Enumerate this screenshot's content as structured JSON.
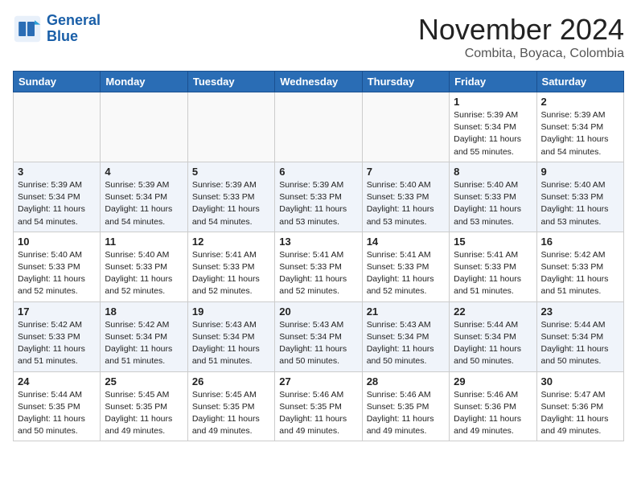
{
  "header": {
    "logo_line1": "General",
    "logo_line2": "Blue",
    "month": "November 2024",
    "location": "Combita, Boyaca, Colombia"
  },
  "days_of_week": [
    "Sunday",
    "Monday",
    "Tuesday",
    "Wednesday",
    "Thursday",
    "Friday",
    "Saturday"
  ],
  "weeks": [
    [
      {
        "day": "",
        "info": ""
      },
      {
        "day": "",
        "info": ""
      },
      {
        "day": "",
        "info": ""
      },
      {
        "day": "",
        "info": ""
      },
      {
        "day": "",
        "info": ""
      },
      {
        "day": "1",
        "info": "Sunrise: 5:39 AM\nSunset: 5:34 PM\nDaylight: 11 hours and 55 minutes."
      },
      {
        "day": "2",
        "info": "Sunrise: 5:39 AM\nSunset: 5:34 PM\nDaylight: 11 hours and 54 minutes."
      }
    ],
    [
      {
        "day": "3",
        "info": "Sunrise: 5:39 AM\nSunset: 5:34 PM\nDaylight: 11 hours and 54 minutes."
      },
      {
        "day": "4",
        "info": "Sunrise: 5:39 AM\nSunset: 5:34 PM\nDaylight: 11 hours and 54 minutes."
      },
      {
        "day": "5",
        "info": "Sunrise: 5:39 AM\nSunset: 5:33 PM\nDaylight: 11 hours and 54 minutes."
      },
      {
        "day": "6",
        "info": "Sunrise: 5:39 AM\nSunset: 5:33 PM\nDaylight: 11 hours and 53 minutes."
      },
      {
        "day": "7",
        "info": "Sunrise: 5:40 AM\nSunset: 5:33 PM\nDaylight: 11 hours and 53 minutes."
      },
      {
        "day": "8",
        "info": "Sunrise: 5:40 AM\nSunset: 5:33 PM\nDaylight: 11 hours and 53 minutes."
      },
      {
        "day": "9",
        "info": "Sunrise: 5:40 AM\nSunset: 5:33 PM\nDaylight: 11 hours and 53 minutes."
      }
    ],
    [
      {
        "day": "10",
        "info": "Sunrise: 5:40 AM\nSunset: 5:33 PM\nDaylight: 11 hours and 52 minutes."
      },
      {
        "day": "11",
        "info": "Sunrise: 5:40 AM\nSunset: 5:33 PM\nDaylight: 11 hours and 52 minutes."
      },
      {
        "day": "12",
        "info": "Sunrise: 5:41 AM\nSunset: 5:33 PM\nDaylight: 11 hours and 52 minutes."
      },
      {
        "day": "13",
        "info": "Sunrise: 5:41 AM\nSunset: 5:33 PM\nDaylight: 11 hours and 52 minutes."
      },
      {
        "day": "14",
        "info": "Sunrise: 5:41 AM\nSunset: 5:33 PM\nDaylight: 11 hours and 52 minutes."
      },
      {
        "day": "15",
        "info": "Sunrise: 5:41 AM\nSunset: 5:33 PM\nDaylight: 11 hours and 51 minutes."
      },
      {
        "day": "16",
        "info": "Sunrise: 5:42 AM\nSunset: 5:33 PM\nDaylight: 11 hours and 51 minutes."
      }
    ],
    [
      {
        "day": "17",
        "info": "Sunrise: 5:42 AM\nSunset: 5:33 PM\nDaylight: 11 hours and 51 minutes."
      },
      {
        "day": "18",
        "info": "Sunrise: 5:42 AM\nSunset: 5:34 PM\nDaylight: 11 hours and 51 minutes."
      },
      {
        "day": "19",
        "info": "Sunrise: 5:43 AM\nSunset: 5:34 PM\nDaylight: 11 hours and 51 minutes."
      },
      {
        "day": "20",
        "info": "Sunrise: 5:43 AM\nSunset: 5:34 PM\nDaylight: 11 hours and 50 minutes."
      },
      {
        "day": "21",
        "info": "Sunrise: 5:43 AM\nSunset: 5:34 PM\nDaylight: 11 hours and 50 minutes."
      },
      {
        "day": "22",
        "info": "Sunrise: 5:44 AM\nSunset: 5:34 PM\nDaylight: 11 hours and 50 minutes."
      },
      {
        "day": "23",
        "info": "Sunrise: 5:44 AM\nSunset: 5:34 PM\nDaylight: 11 hours and 50 minutes."
      }
    ],
    [
      {
        "day": "24",
        "info": "Sunrise: 5:44 AM\nSunset: 5:35 PM\nDaylight: 11 hours and 50 minutes."
      },
      {
        "day": "25",
        "info": "Sunrise: 5:45 AM\nSunset: 5:35 PM\nDaylight: 11 hours and 49 minutes."
      },
      {
        "day": "26",
        "info": "Sunrise: 5:45 AM\nSunset: 5:35 PM\nDaylight: 11 hours and 49 minutes."
      },
      {
        "day": "27",
        "info": "Sunrise: 5:46 AM\nSunset: 5:35 PM\nDaylight: 11 hours and 49 minutes."
      },
      {
        "day": "28",
        "info": "Sunrise: 5:46 AM\nSunset: 5:35 PM\nDaylight: 11 hours and 49 minutes."
      },
      {
        "day": "29",
        "info": "Sunrise: 5:46 AM\nSunset: 5:36 PM\nDaylight: 11 hours and 49 minutes."
      },
      {
        "day": "30",
        "info": "Sunrise: 5:47 AM\nSunset: 5:36 PM\nDaylight: 11 hours and 49 minutes."
      }
    ]
  ]
}
